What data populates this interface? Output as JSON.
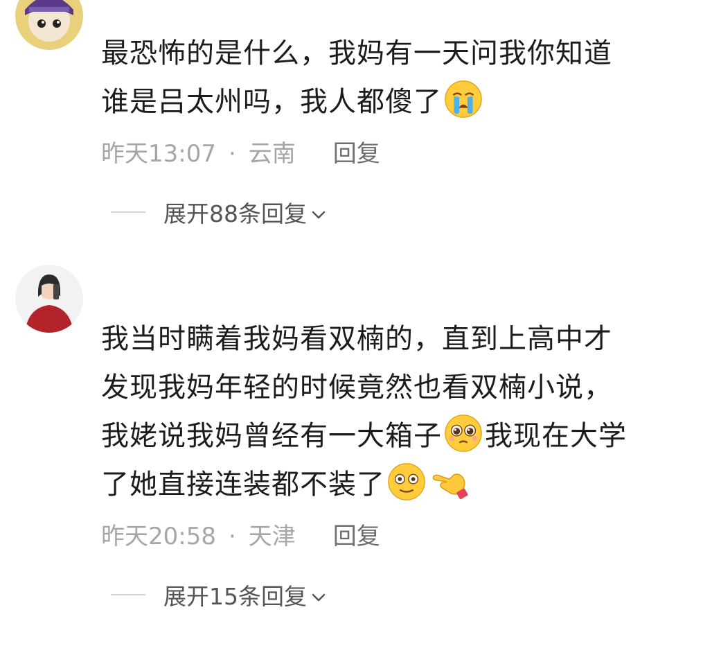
{
  "comments": [
    {
      "text_line1": "最恐怖的是什么，我妈有一天问我你知道",
      "text_line2": "谁是吕太州吗，我人都傻了",
      "emoji_end": "loudly-crying-face",
      "time": "昨天13:07",
      "separator": "·",
      "location": "云南",
      "reply_label": "回复",
      "expand_label": "展开88条回复"
    },
    {
      "text_line1": "我当时瞒着我妈看双楠的，直到上高中才",
      "text_line2": "发现我妈年轻的时候竟然也看双楠小说，",
      "text_line3a": "我姥说我妈曾经有一大箱子",
      "emoji_mid": "pleading-face",
      "text_line3b": "我现在大学",
      "text_line4": "了她直接连装都不装了",
      "emoji_end_1": "flushed-face",
      "emoji_end_2": "pointing-hand",
      "time": "昨天20:58",
      "separator": "·",
      "location": "天津",
      "reply_label": "回复",
      "expand_label": "展开15条回复"
    }
  ],
  "colors": {
    "text": "#1c1c1c",
    "meta": "#a6a6a6",
    "reply": "#6e6e6e",
    "expand": "#555555"
  }
}
